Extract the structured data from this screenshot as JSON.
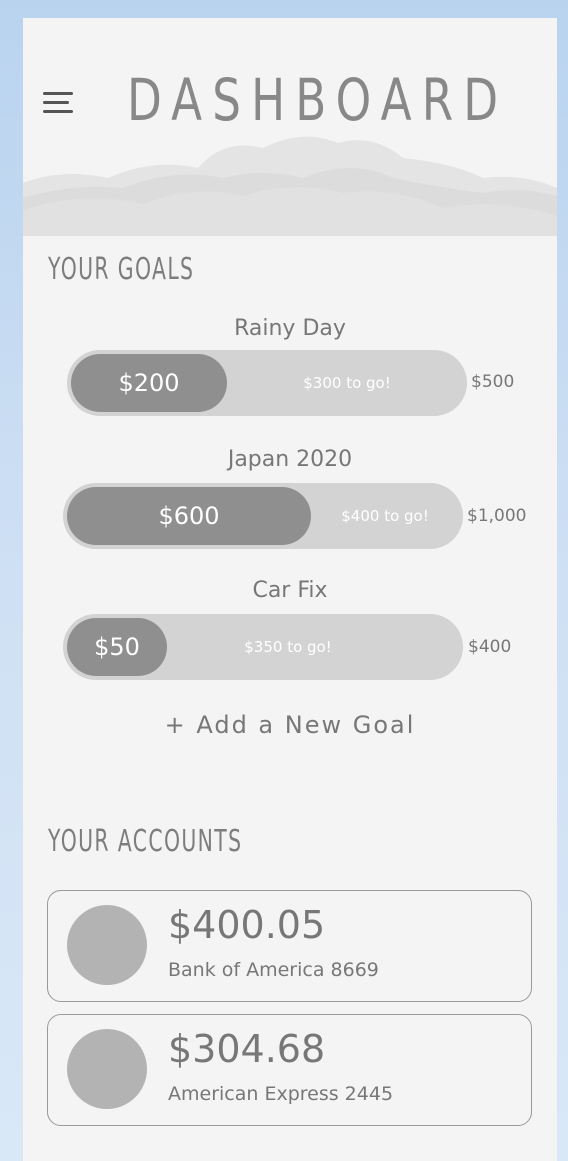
{
  "header": {
    "title": "DASHBOARD",
    "menu_icon": "hamburger-menu-icon"
  },
  "goals_section": {
    "title": "YOUR GOALS",
    "goals": [
      {
        "name": "Rainy Day",
        "saved": "$200",
        "remaining": "$300 to go!",
        "total": "$500",
        "progress": 0.4
      },
      {
        "name": "Japan 2020",
        "saved": "$600",
        "remaining": "$400 to go!",
        "total": "$1,000",
        "progress": 0.6
      },
      {
        "name": "Car Fix",
        "saved": "$50",
        "remaining": "$350 to go!",
        "total": "$400",
        "progress": 0.125
      }
    ],
    "add_label": "+ Add a New Goal"
  },
  "accounts_section": {
    "title": "YOUR ACCOUNTS",
    "accounts": [
      {
        "amount": "$400.05",
        "name": "Bank of America 8669"
      },
      {
        "amount": "$304.68",
        "name": "American Express 2445"
      }
    ]
  },
  "colors": {
    "background": "#f4f4f4",
    "progress_fill": "#8f8f8f",
    "progress_track": "#d3d3d3",
    "avatar": "#b3b3b3",
    "text": "#777777"
  }
}
